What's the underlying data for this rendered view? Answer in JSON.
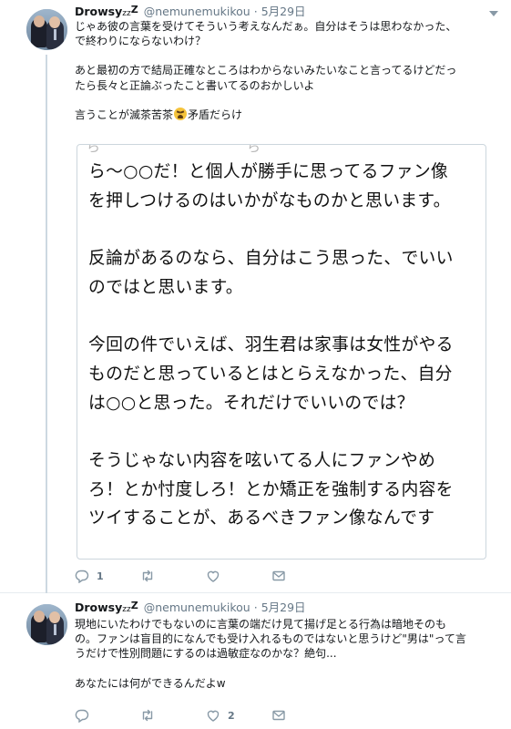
{
  "tweets": [
    {
      "name": "Drowsy",
      "zzz_small": "z",
      "zzz_big": "Z",
      "handle": "@nemunemukikou",
      "separator": "·",
      "date": "5月29日",
      "text_lines": [
        "じゃあ彼の言葉を受けてそういう考えなんだぁ。自分はそうは思わなかった、",
        "で終わりにならないわけ？",
        "",
        "あと最初の方で結局正確なところはわからないみたいなこと言ってるけどだっ",
        "たら長々と正論ぶったこと書いてるのおかしいよ",
        ""
      ],
      "last_line_before_emoji": "言うことが滅茶苦茶",
      "last_line_after_emoji": "矛盾だらけ",
      "emoji": "tired-face-emoji",
      "embed": {
        "cut_text_1": "ら",
        "cut_text_2": "ら",
        "lines": [
          "ら〜○○だ！と個人が勝手に思ってるファン像",
          "を押しつけるのはいかがなものかと思います。",
          "",
          "反論があるのなら、自分はこう思った、でいい",
          "のではと思います。",
          "",
          "今回の件でいえば、羽生君は家事は女性がやる",
          "ものだと思っているとはとらえなかった、自分",
          "は○○と思った。それだけでいいのでは？",
          "",
          "そうじゃない内容を呟いてる人にファンやめ",
          "ろ！とか忖度しろ！とか矯正を強制する内容を",
          "ツイすることが、あるべきファン像なんです"
        ]
      },
      "actions": {
        "reply_count": "1",
        "retweet_count": "",
        "like_count": "",
        "dm_count": ""
      }
    },
    {
      "name": "Drowsy",
      "zzz_small": "z",
      "zzz_big": "Z",
      "handle": "@nemunemukikou",
      "separator": "·",
      "date": "5月29日",
      "text_lines": [
        "現地にいたわけでもないのに言葉の端だけ見て揚げ足とる行為は暗地そのも",
        "の。ファンは盲目的になんでも受け入れるものではないと思うけど\"男は\"って言",
        "うだけで性別問題にするのは過敏症なのかな？絶句...",
        "",
        "あなたには何ができるんだよw"
      ],
      "actions": {
        "reply_count": "",
        "retweet_count": "",
        "like_count": "2",
        "dm_count": ""
      }
    }
  ],
  "colors": {
    "text": "#14171a",
    "muted": "#657786",
    "icon": "#8899a6",
    "thread_line": "#cdd8e1",
    "border": "#e6ecf0"
  }
}
